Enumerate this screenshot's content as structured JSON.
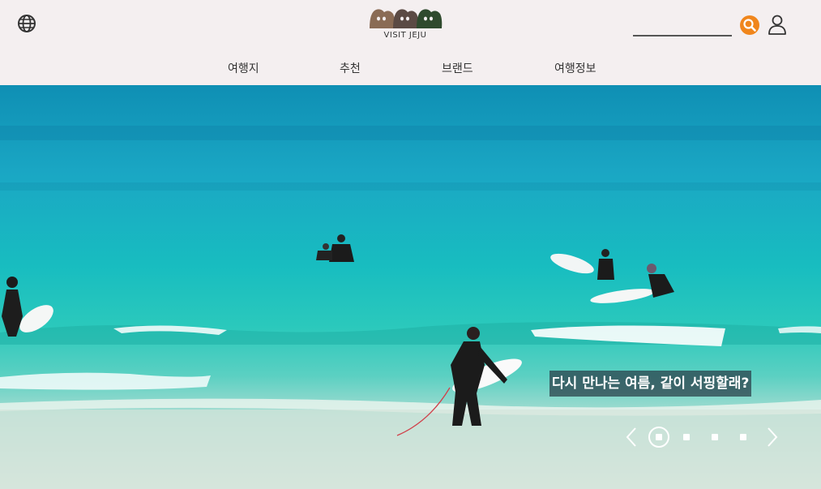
{
  "header": {
    "logo_text": "VISIT JEJU",
    "search_placeholder": "",
    "search_accent": "#f0861c"
  },
  "nav": {
    "items": [
      {
        "label": "여행지"
      },
      {
        "label": "추천"
      },
      {
        "label": "브랜드"
      },
      {
        "label": "여행정보"
      }
    ]
  },
  "hero": {
    "caption": "다시 만나는 여름, 같이 서핑할래?",
    "slides_total": 4,
    "active_slide": 1
  },
  "colors": {
    "header_bg": "#f4eff0",
    "logo_brown": "#8a6b55",
    "logo_darkbrown": "#5b4a44",
    "logo_green": "#2f4a2e"
  }
}
